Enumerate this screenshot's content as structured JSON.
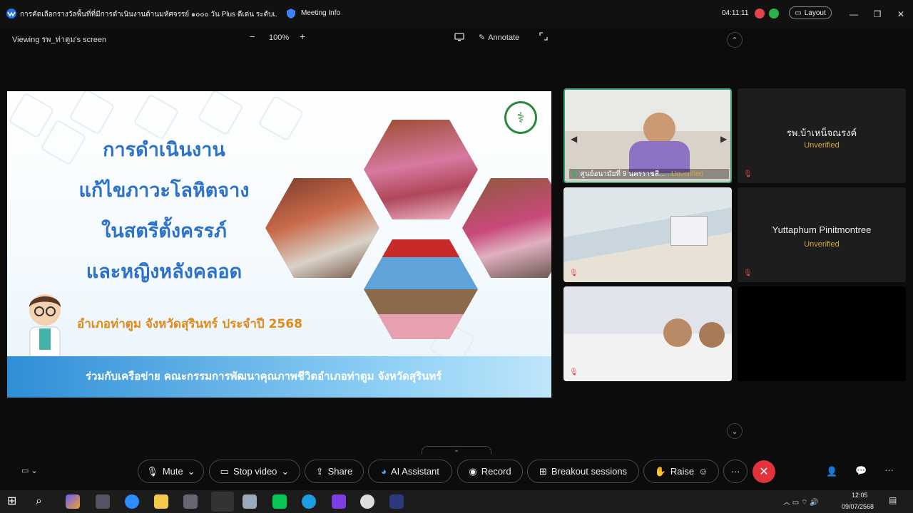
{
  "window": {
    "app_title": "การคัดเลือกรางวัลพื้นที่ที่มีการดำเนินงานด้านมหัศจรรย์ ๑๐๐๐ วัน Plus ดีเด่น ระดับเ...",
    "meeting_info": "Meeting Info",
    "timer": "04:11:11",
    "layout_label": "Layout"
  },
  "subbar": {
    "viewing": "Viewing รพ_ท่าตูม's screen",
    "zoom_out": "−",
    "zoom_level": "100%",
    "zoom_in": "+",
    "annotate": "Annotate"
  },
  "slide": {
    "lines": [
      "การดำเนินงาน",
      "แก้ไขภาวะโลหิตจาง",
      "ในสตรีตั้งครรภ์",
      "และหญิงหลังคลอด"
    ],
    "subtitle": "อำเภอท่าตูม  จังหวัดสุรินทร์ ประจำปี 2568",
    "footer": "ร่วมกับเครือข่าย คณะกรรมการพัฒนาคุณภาพชีวิตอำเภอท่าตูม  จังหวัดสุรินทร์"
  },
  "tiles": {
    "t1_label": "ศูนย์อนามัยที่ 9 นครราชสี...",
    "t1_status": "Unverified",
    "t2_name": "รพ.บ้าเหน็จณรงค์",
    "t2_status": "Unverified",
    "t4_name": "Yuttaphum Pinitmontree",
    "t4_status": "Unverified"
  },
  "controls": {
    "mute": "Mute",
    "stop_video": "Stop video",
    "share": "Share",
    "ai_assistant": "AI Assistant",
    "record": "Record",
    "breakout": "Breakout sessions",
    "raise": "Raise",
    "more": "···"
  },
  "taskbar": {
    "time": "12:05",
    "date": "09/07/2568"
  },
  "colors": {
    "end_button": "#e2323c",
    "unverified": "#d4a83a",
    "slide_title": "#2c72c9",
    "slide_subtitle": "#e08a1a"
  }
}
